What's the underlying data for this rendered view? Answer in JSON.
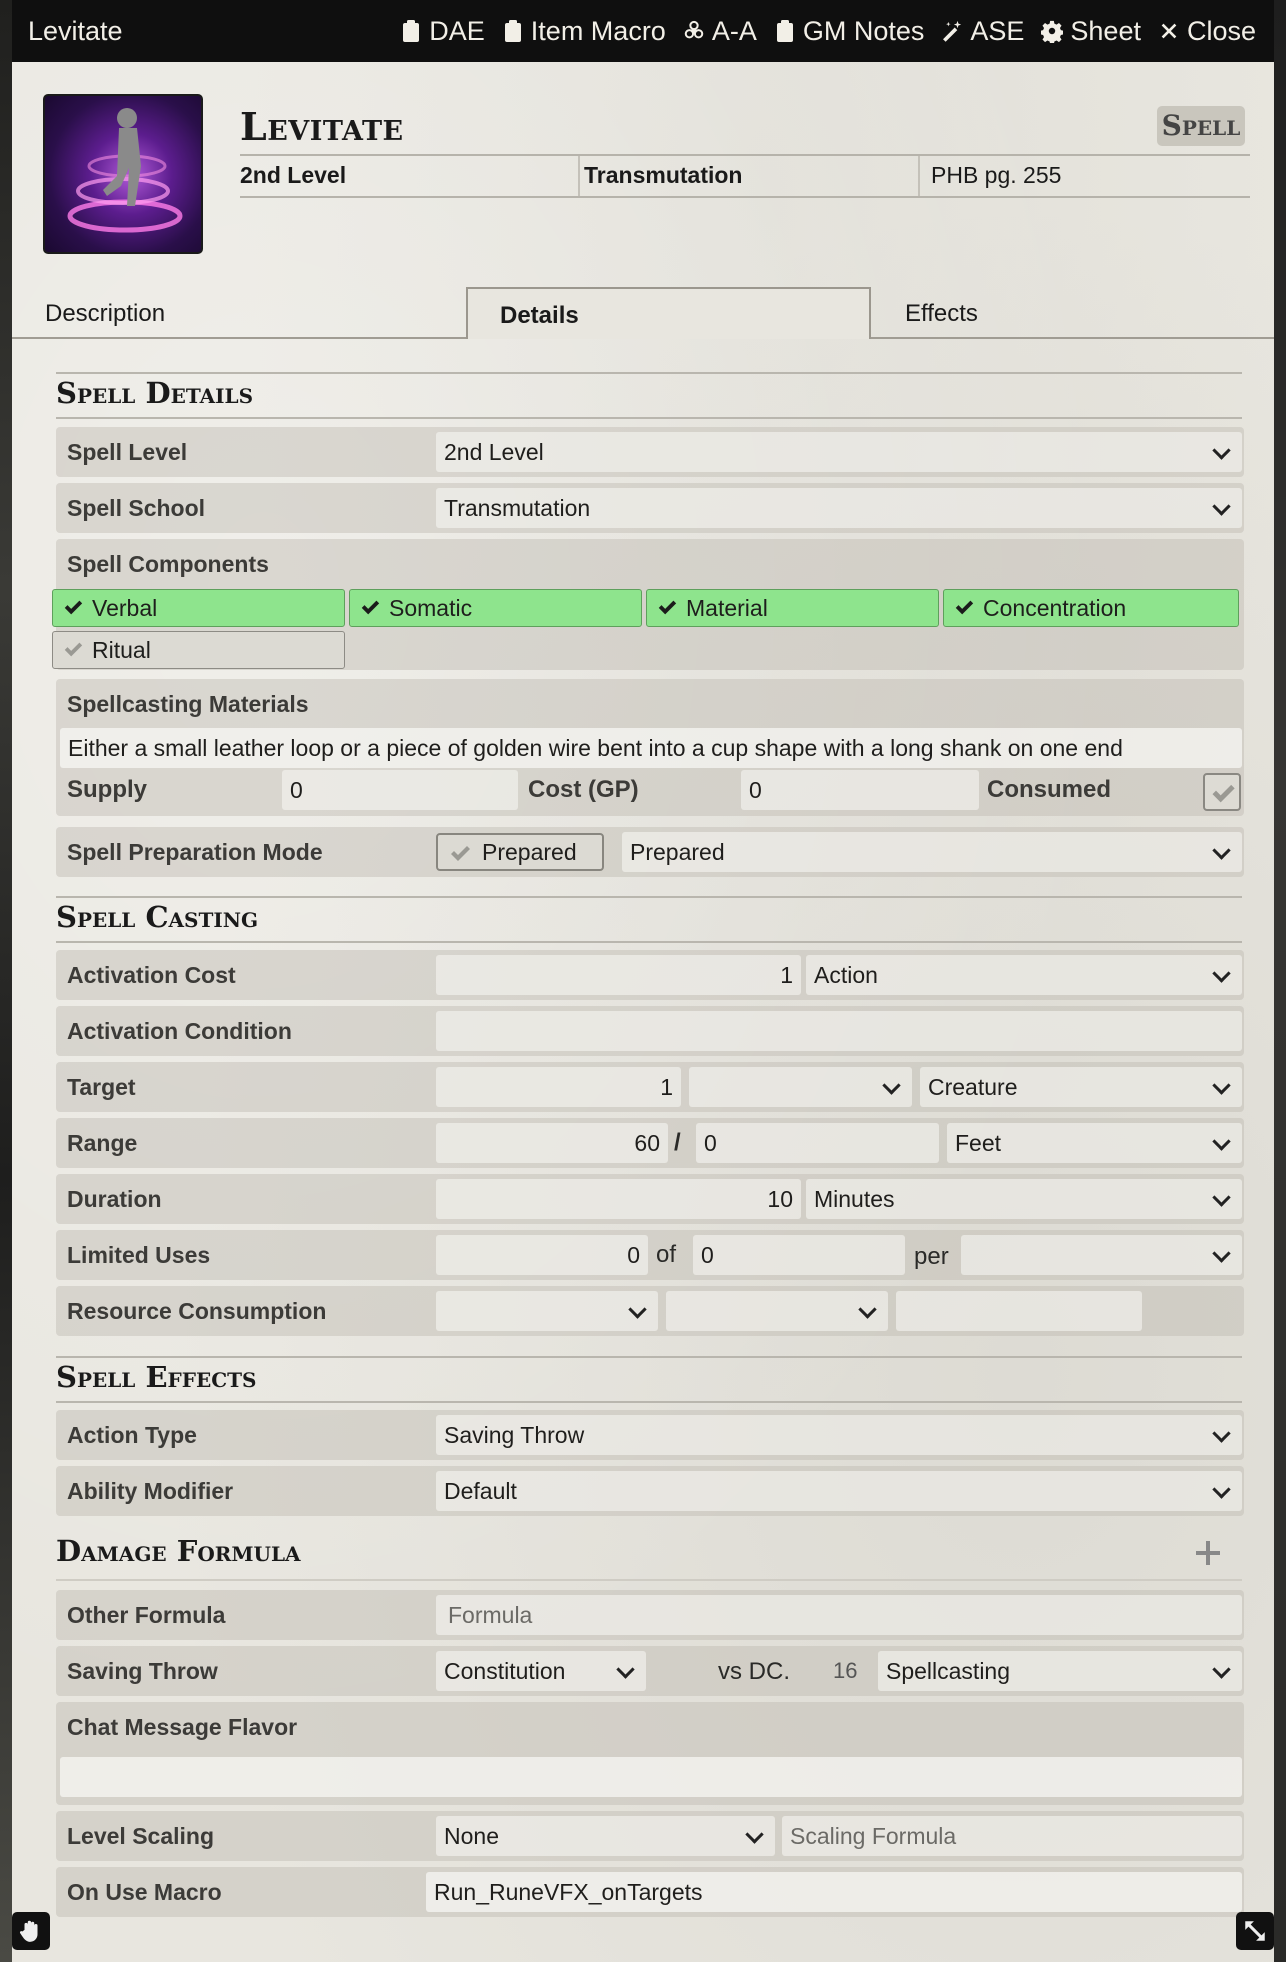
{
  "window": {
    "title": "Levitate",
    "header_buttons": [
      {
        "label": "DAE",
        "icon": "clipboard-icon"
      },
      {
        "label": "Item Macro",
        "icon": "clipboard-icon"
      },
      {
        "label": "A-A",
        "icon": "biohazard-icon"
      },
      {
        "label": "GM Notes",
        "icon": "clipboard-icon"
      },
      {
        "label": "ASE",
        "icon": "magic-wand-icon"
      },
      {
        "label": "Sheet",
        "icon": "gear-icon"
      },
      {
        "label": "Close",
        "icon": "close-icon"
      }
    ]
  },
  "header": {
    "name": "Levitate",
    "type": "Spell",
    "level": "2nd Level",
    "school": "Transmutation",
    "source": "PHB pg. 255"
  },
  "tabs": {
    "description": "Description",
    "details": "Details",
    "effects": "Effects"
  },
  "spell_details": {
    "title": "Spell Details",
    "level_label": "Spell Level",
    "level_value": "2nd Level",
    "school_label": "Spell School",
    "school_value": "Transmutation",
    "components_label": "Spell Components",
    "components": [
      {
        "label": "Verbal",
        "checked": true
      },
      {
        "label": "Somatic",
        "checked": true
      },
      {
        "label": "Material",
        "checked": true
      },
      {
        "label": "Concentration",
        "checked": true
      },
      {
        "label": "Ritual",
        "checked": false
      }
    ],
    "materials_label": "Spellcasting Materials",
    "materials_value": "Either a small leather loop or a piece of golden wire bent into a cup shape with a long shank on one end",
    "supply_label": "Supply",
    "supply_value": "0",
    "cost_label": "Cost (GP)",
    "cost_value": "0",
    "consumed_label": "Consumed",
    "prep_label": "Spell Preparation Mode",
    "prep_toggle": "Prepared",
    "prep_mode": "Prepared"
  },
  "spell_casting": {
    "title": "Spell Casting",
    "activation_cost_label": "Activation Cost",
    "activation_cost_value": "1",
    "activation_type": "Action",
    "activation_condition_label": "Activation Condition",
    "activation_condition_value": "",
    "target_label": "Target",
    "target_value": "1",
    "target_units": "",
    "target_type": "Creature",
    "range_label": "Range",
    "range_value": "60",
    "range_sep": "/",
    "range_long": "0",
    "range_units": "Feet",
    "duration_label": "Duration",
    "duration_value": "10",
    "duration_units": "Minutes",
    "uses_label": "Limited Uses",
    "uses_value": "0",
    "uses_of": "of",
    "uses_max": "0",
    "uses_per_label": "per",
    "uses_per": "",
    "consume_label": "Resource Consumption",
    "consume_type": "",
    "consume_target": "",
    "consume_amount": ""
  },
  "spell_effects": {
    "title": "Spell Effects",
    "action_type_label": "Action Type",
    "action_type_value": "Saving Throw",
    "ability_label": "Ability Modifier",
    "ability_value": "Default",
    "damage_title": "Damage Formula",
    "other_formula_label": "Other Formula",
    "other_formula_placeholder": "Formula",
    "save_label": "Saving Throw",
    "save_ability": "Constitution",
    "save_vs": "vs DC.",
    "save_dc": "16",
    "save_scaling": "Spellcasting",
    "chat_flavor_label": "Chat Message Flavor",
    "chat_flavor_value": "",
    "scaling_label": "Level Scaling",
    "scaling_mode": "None",
    "scaling_formula_placeholder": "Scaling Formula",
    "macro_label": "On Use Macro",
    "macro_value": "Run_RuneVFX_onTargets"
  },
  "colors": {
    "component_on": "#8ee48d",
    "titlebar": "#0f0f0f",
    "sheet_bg": "#e8e6df"
  }
}
